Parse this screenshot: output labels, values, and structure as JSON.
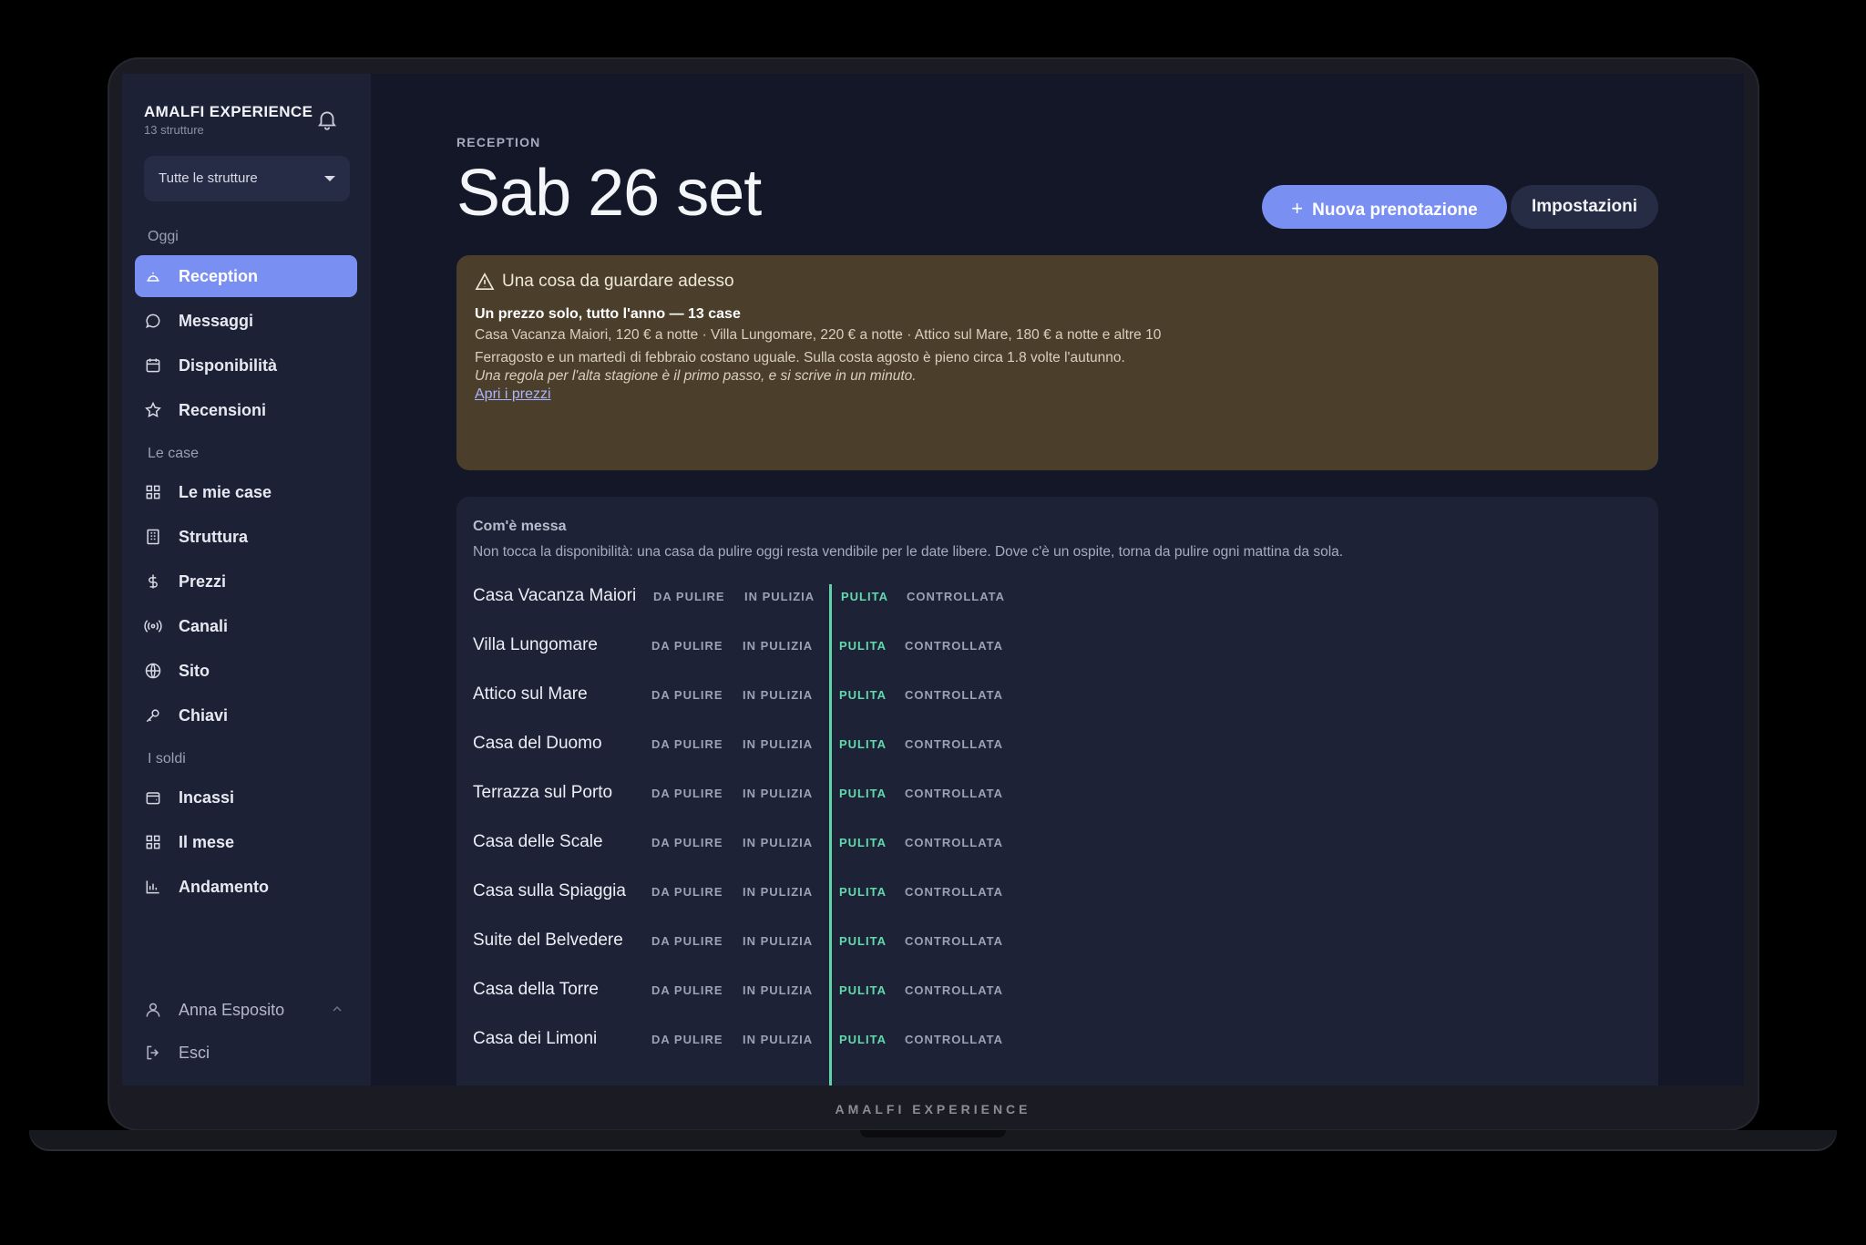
{
  "device": {
    "footer_brand": "AMALFI EXPERIENCE"
  },
  "sidebar": {
    "org_name": "AMALFI EXPERIENCE",
    "org_sub": "13 strutture",
    "selector": "Tutte le strutture",
    "sections": {
      "today": "Oggi",
      "houses": "Le case",
      "money": "I soldi"
    },
    "items": [
      {
        "label": "Reception",
        "icon": "bell-desk-icon",
        "active": true
      },
      {
        "label": "Messaggi",
        "icon": "chat-icon"
      },
      {
        "label": "Disponibilità",
        "icon": "calendar-icon"
      },
      {
        "label": "Recensioni",
        "icon": "star-icon"
      },
      {
        "label": "Le mie case",
        "icon": "grid-icon"
      },
      {
        "label": "Struttura",
        "icon": "building-icon"
      },
      {
        "label": "Prezzi",
        "icon": "dollar-icon"
      },
      {
        "label": "Canali",
        "icon": "broadcast-icon"
      },
      {
        "label": "Sito",
        "icon": "globe-icon"
      },
      {
        "label": "Chiavi",
        "icon": "key-icon"
      },
      {
        "label": "Incassi",
        "icon": "wallet-icon"
      },
      {
        "label": "Il mese",
        "icon": "grid-icon"
      },
      {
        "label": "Andamento",
        "icon": "bar-chart-icon"
      }
    ],
    "user": "Anna Esposito",
    "logout": "Esci"
  },
  "header": {
    "eyebrow": "RECEPTION",
    "title": "Sab 26 set",
    "primary_button": "Nuova prenotazione",
    "secondary_button": "Impostazioni"
  },
  "alert": {
    "heading": "Una cosa da guardare adesso",
    "title": "Un prezzo solo, tutto l'anno — 13 case",
    "body_1": "Casa Vacanza Maiori, 120 € a notte · Villa Lungomare, 220 € a notte · Attico sul Mare, 180 € a notte e altre 10",
    "body_2": "Ferragosto e un martedì di febbraio costano uguale. Sulla costa agosto è pieno circa 1.8 volte l'autunno.",
    "note": "Una regola per l'alta stagione è il primo passo, e si scrive in un minuto.",
    "link": "Apri i prezzi",
    "color": "#4b3f2b"
  },
  "panel": {
    "title": "Com'è messa",
    "subtitle": "Non tocca la disponibilità: una casa da pulire oggi resta vendibile per le date libere. Dove c'è un ospite, torna da pulire ogni mattina da sola.",
    "states": [
      "DA PULIRE",
      "IN PULIZIA",
      "PULITA",
      "CONTROLLATA"
    ],
    "current_state": "PULITA",
    "rows": [
      "Casa Vacanza Maiori",
      "Villa Lungomare",
      "Attico sul Mare",
      "Casa del Duomo",
      "Terrazza sul Porto",
      "Casa delle Scale",
      "Casa sulla Spiaggia",
      "Suite del Belvedere",
      "Casa della Torre",
      "Casa dei Limoni"
    ]
  },
  "colors": {
    "accent": "#7a8ff2",
    "good": "#62d9ac",
    "background": "#131728"
  }
}
